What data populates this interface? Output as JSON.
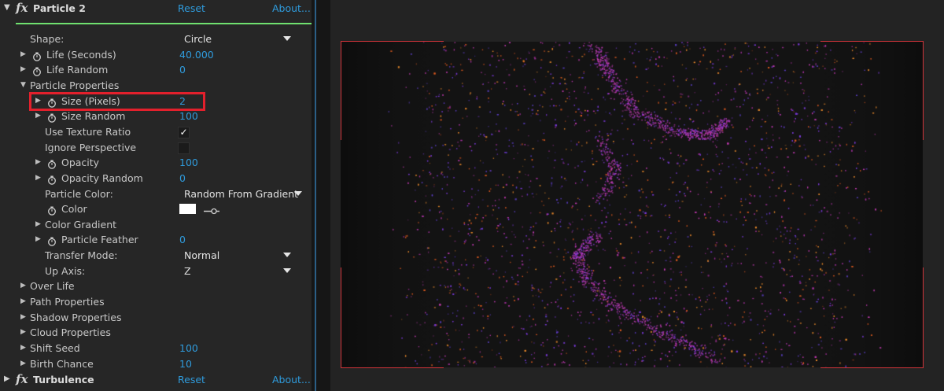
{
  "effects": [
    {
      "name": "Particle 2",
      "reset": "Reset",
      "about": "About..."
    },
    {
      "name": "Turbulence",
      "reset": "Reset",
      "about": "About..."
    }
  ],
  "fx_glyph": "fx",
  "props": [
    {
      "label": "Shape:",
      "indent": 0,
      "twirl": false,
      "stopwatch": false,
      "kind": "dropdown",
      "value": "Circle"
    },
    {
      "label": "Life (Seconds)",
      "indent": 0,
      "twirl": true,
      "stopwatch": true,
      "kind": "number",
      "value": "40.000"
    },
    {
      "label": "Life Random",
      "indent": 0,
      "twirl": true,
      "stopwatch": true,
      "kind": "number",
      "value": "0"
    },
    {
      "label": "Particle Properties",
      "indent": 0,
      "twirl": "open",
      "stopwatch": false,
      "kind": "none",
      "value": ""
    },
    {
      "label": "Size (Pixels)",
      "indent": 1,
      "twirl": true,
      "stopwatch": true,
      "kind": "number",
      "value": "2",
      "highlighted": true
    },
    {
      "label": "Size Random",
      "indent": 1,
      "twirl": true,
      "stopwatch": true,
      "kind": "number",
      "value": "100"
    },
    {
      "label": "Use Texture Ratio",
      "indent": 1,
      "twirl": false,
      "stopwatch": false,
      "kind": "checkbox",
      "checked": true
    },
    {
      "label": "Ignore Perspective",
      "indent": 1,
      "twirl": false,
      "stopwatch": false,
      "kind": "checkbox",
      "checked": false
    },
    {
      "label": "Opacity",
      "indent": 1,
      "twirl": true,
      "stopwatch": true,
      "kind": "number",
      "value": "100"
    },
    {
      "label": "Opacity Random",
      "indent": 1,
      "twirl": true,
      "stopwatch": true,
      "kind": "number",
      "value": "0"
    },
    {
      "label": "Particle Color:",
      "indent": 1,
      "twirl": false,
      "stopwatch": false,
      "kind": "dropdown",
      "value": "Random From Gradient"
    },
    {
      "label": "Color",
      "indent": 1,
      "twirl": false,
      "stopwatch": true,
      "kind": "color",
      "value": "#ffffff"
    },
    {
      "label": "Color Gradient",
      "indent": 1,
      "twirl": true,
      "stopwatch": false,
      "kind": "none",
      "value": ""
    },
    {
      "label": "Particle Feather",
      "indent": 1,
      "twirl": true,
      "stopwatch": true,
      "kind": "number",
      "value": "0"
    },
    {
      "label": "Transfer Mode:",
      "indent": 1,
      "twirl": false,
      "stopwatch": false,
      "kind": "dropdown",
      "value": "Normal"
    },
    {
      "label": "Up Axis:",
      "indent": 1,
      "twirl": false,
      "stopwatch": false,
      "kind": "dropdown",
      "value": "Z"
    },
    {
      "label": "Over Life",
      "indent": 0,
      "twirl": true,
      "stopwatch": false,
      "kind": "none",
      "value": ""
    },
    {
      "label": "Path Properties",
      "indent": 0,
      "twirl": true,
      "stopwatch": false,
      "kind": "none",
      "value": ""
    },
    {
      "label": "Shadow Properties",
      "indent": 0,
      "twirl": true,
      "stopwatch": false,
      "kind": "none",
      "value": ""
    },
    {
      "label": "Cloud Properties",
      "indent": 0,
      "twirl": true,
      "stopwatch": false,
      "kind": "none",
      "value": ""
    },
    {
      "label": "Shift Seed",
      "indent": 0,
      "twirl": true,
      "stopwatch": false,
      "kind": "number",
      "value": "100"
    },
    {
      "label": "Birth Chance",
      "indent": 0,
      "twirl": true,
      "stopwatch": false,
      "kind": "number",
      "value": "10"
    }
  ],
  "colors": {
    "value_blue": "#2f9bdc",
    "highlight_red": "#e3202c",
    "underline_green": "#6fe06f",
    "guide_red": "#d2343a",
    "particle_palette": [
      "#c03ab0",
      "#7a3ad8",
      "#d8581f",
      "#e0842a",
      "#a0309a",
      "#5a3ec0"
    ]
  },
  "viewer": {
    "content": "particle-field"
  }
}
